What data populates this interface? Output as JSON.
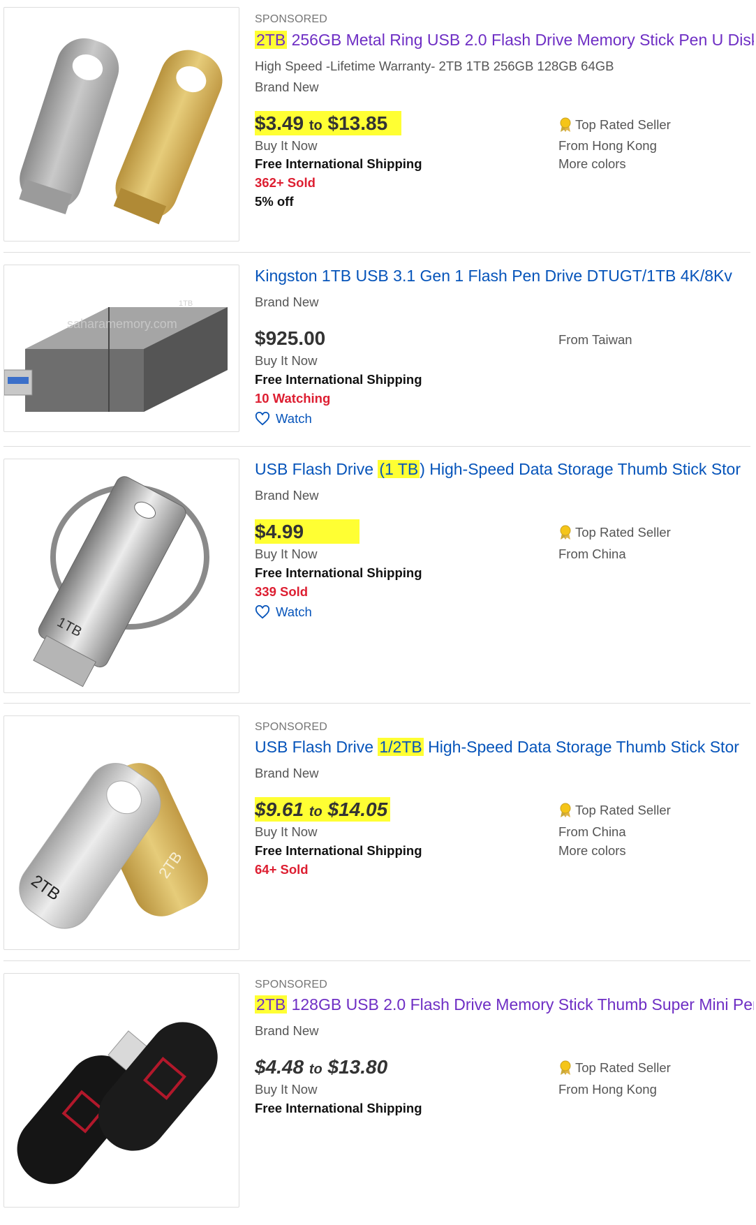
{
  "listings": [
    {
      "sponsored": "SPONSORED",
      "title_hl": "2TB",
      "title_rest": " 256GB Metal Ring USB 2.0 Flash Drive Memory Stick Pen U Disk",
      "subtitle": "High Speed -Lifetime Warranty- 2TB 1TB 256GB 128GB 64GB",
      "condition": "Brand New",
      "price_a": "$3.49",
      "price_to": "to",
      "price_b": "$13.85",
      "bin": "Buy It Now",
      "shipping": "Free International Shipping",
      "sold": "362+ Sold",
      "discount": "5% off",
      "top_rated": "Top Rated Seller",
      "location": "From Hong Kong",
      "more": "More colors"
    },
    {
      "title": "Kingston 1TB USB 3.1 Gen 1 Flash Pen Drive DTUGT/1TB 4K/8Kv",
      "condition": "Brand New",
      "price": "$925.00",
      "bin": "Buy It Now",
      "shipping": "Free International Shipping",
      "watching": "10 Watching",
      "watch": "Watch",
      "location": "From Taiwan",
      "image_watermark": "saharamemory.com",
      "image_cap_text": "1TB"
    },
    {
      "title_pre": "USB Flash Drive ",
      "title_hl": "(1 TB",
      "title_post": ") High-Speed Data Storage Thumb Stick Stor",
      "condition": "Brand New",
      "price": "$4.99",
      "bin": "Buy It Now",
      "shipping": "Free International Shipping",
      "sold": "339 Sold",
      "watch": "Watch",
      "top_rated": "Top Rated Seller",
      "location": "From China",
      "image_label": "1TB"
    },
    {
      "sponsored": "SPONSORED",
      "title_pre": "USB Flash Drive ",
      "title_hl": "1/2TB",
      "title_post": " High-Speed Data Storage Thumb Stick Stor",
      "condition": "Brand New",
      "price_a": "$9.61",
      "price_to": "to",
      "price_b": "$14.05",
      "bin": "Buy It Now",
      "shipping": "Free International Shipping",
      "sold": "64+ Sold",
      "top_rated": "Top Rated Seller",
      "location": "From China",
      "more": "More colors",
      "image_label_a": "2TB",
      "image_label_b": "2TB"
    },
    {
      "sponsored": "SPONSORED",
      "title_hl": "2TB",
      "title_rest": " 128GB USB 2.0 Flash Drive Memory Stick Thumb Super Mini Pen",
      "condition": "Brand New",
      "price_a": "$4.48",
      "price_to": "to",
      "price_b": "$13.80",
      "bin": "Buy It Now",
      "shipping": "Free International Shipping",
      "top_rated": "Top Rated Seller",
      "location": "From Hong Kong"
    }
  ]
}
